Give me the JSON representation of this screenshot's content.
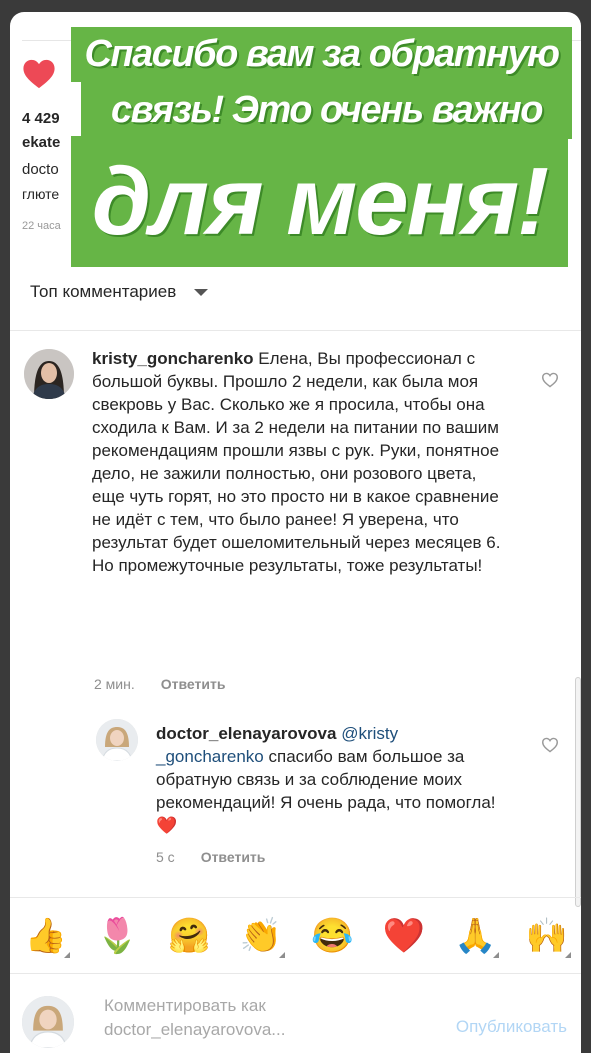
{
  "post": {
    "likes_count": "4 429",
    "author_fragment": "ekate",
    "caption_line1": "docto",
    "caption_line2": "глюте",
    "time_fragment": "22 часа"
  },
  "banner": {
    "line1": "Спасибо вам за обратную",
    "line2": "связь! Это очень важно",
    "line3": "для меня!"
  },
  "sort": {
    "label": "Топ комментариев"
  },
  "comments": [
    {
      "username": "kristy_goncharenko",
      "text": "Елена, Вы профессионал с большой буквы. Прошло 2 недели, как была моя свекровь у Вас. Сколько же я просила, чтобы она сходила к Вам. И за 2 недели на питании по вашим рекомендациям прошли язвы с рук. Руки, понятное дело, не зажили полностью, они розового цвета, еще чуть горят, но это просто ни в какое сравнение не идёт с тем, что было ранее! Я уверена, что результат будет ошеломительный через месяцев 6. Но промежуточные результаты, тоже результаты!",
      "time": "2 мин.",
      "reply_label": "Ответить"
    },
    {
      "username": "doctor_elenayarovova",
      "mention": "@kristy _goncharenko",
      "text": "спасибо вам большое за обратную связь и за соблюдение моих рекомендаций! Я очень рада, что помогла!",
      "emoji": "❤️",
      "time": "5 с",
      "reply_label": "Ответить"
    }
  ],
  "emoji_bar": [
    "👍",
    "🌷",
    "🤗",
    "👏",
    "😂",
    "❤️",
    "🙏",
    "🙌"
  ],
  "composer": {
    "placeholder_line1": "Комментировать как",
    "placeholder_line2": "doctor_elenayarovova...",
    "publish_label": "Опубликовать"
  },
  "colors": {
    "banner_green": "#66b546",
    "heart_red": "#ed4956",
    "link_blue": "#1e4e7a",
    "publish_disabled": "#b2d6f5"
  }
}
